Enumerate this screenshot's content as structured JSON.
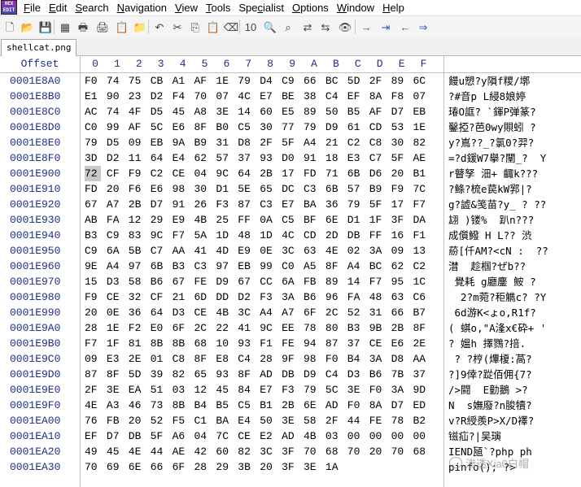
{
  "menu": {
    "items": [
      "File",
      "Edit",
      "Search",
      "Navigation",
      "View",
      "Tools",
      "Specialist",
      "Options",
      "Window",
      "Help"
    ],
    "mnemonics": [
      "F",
      "E",
      "S",
      "N",
      "V",
      "T",
      "c",
      "O",
      "W",
      "H"
    ]
  },
  "app_logo": "HEX EDIT",
  "toolbar": {
    "buttons": [
      {
        "name": "new-file-icon",
        "glyph": "🗋"
      },
      {
        "name": "open-file-icon",
        "glyph": "📂"
      },
      {
        "name": "save-icon",
        "glyph": "💾"
      },
      {
        "name": "save-all-icon",
        "glyph": "▦"
      },
      {
        "name": "print-icon",
        "glyph": "🖶"
      },
      {
        "name": "print-preview-icon",
        "glyph": "🖨"
      },
      {
        "name": "properties-icon",
        "glyph": "📋"
      },
      {
        "name": "folder-icon",
        "glyph": "📁"
      },
      {
        "name": "undo-icon",
        "glyph": "↶"
      },
      {
        "name": "cut-icon",
        "glyph": "✂"
      },
      {
        "name": "copy-icon",
        "glyph": "⎘"
      },
      {
        "name": "paste-icon",
        "glyph": "📋"
      },
      {
        "name": "delete-icon",
        "glyph": "⌫"
      },
      {
        "name": "insert-bits-icon",
        "glyph": "10"
      },
      {
        "name": "find-icon",
        "glyph": "🔍"
      },
      {
        "name": "find-hex-icon",
        "glyph": "⌕"
      },
      {
        "name": "replace-icon",
        "glyph": "⇄"
      },
      {
        "name": "replace-hex-icon",
        "glyph": "⇆"
      },
      {
        "name": "binoculars-icon",
        "glyph": "👁"
      },
      {
        "name": "goto-icon",
        "glyph": "→"
      },
      {
        "name": "goto-offset-icon",
        "glyph": "⇥"
      },
      {
        "name": "back-icon",
        "glyph": "←"
      },
      {
        "name": "forward-icon",
        "glyph": "⇒"
      }
    ]
  },
  "tab": {
    "label": "shellcat.png"
  },
  "grid": {
    "offset_header": "Offset",
    "columns": [
      "0",
      "1",
      "2",
      "3",
      "4",
      "5",
      "6",
      "7",
      "8",
      "9",
      "A",
      "B",
      "C",
      "D",
      "E",
      "F"
    ],
    "rows": [
      {
        "offset": "0001E8A0",
        "bytes": [
          "F0",
          "74",
          "75",
          "CB",
          "A1",
          "AF",
          "1E",
          "79",
          "D4",
          "C9",
          "66",
          "BC",
          "5D",
          "2F",
          "89",
          "6C"
        ],
        "ascii": "饅u愬?y隕f糭/墎"
      },
      {
        "offset": "0001E8B0",
        "bytes": [
          "E1",
          "90",
          "23",
          "D2",
          "F4",
          "70",
          "07",
          "4C",
          "E7",
          "BE",
          "38",
          "C4",
          "EF",
          "8A",
          "F8",
          "07"
        ],
        "ascii": "?#音p L綅8娘婷"
      },
      {
        "offset": "0001E8C0",
        "bytes": [
          "AC",
          "74",
          "4F",
          "D5",
          "45",
          "A8",
          "3E",
          "14",
          "60",
          "E5",
          "89",
          "50",
          "B5",
          "AF",
          "D7",
          "EB"
        ],
        "ascii": "瑃O誆? `鍕P弹篆?"
      },
      {
        "offset": "0001E8D0",
        "bytes": [
          "C0",
          "99",
          "AF",
          "5C",
          "E6",
          "8F",
          "B0",
          "C5",
          "30",
          "77",
          "79",
          "D9",
          "61",
          "CD",
          "53",
          "1E"
        ],
        "ascii": "鑿掗?芭0wy賏蚓 ?"
      },
      {
        "offset": "0001E8E0",
        "bytes": [
          "79",
          "D5",
          "09",
          "EB",
          "9A",
          "B9",
          "31",
          "D8",
          "2F",
          "5F",
          "A4",
          "21",
          "C2",
          "C8",
          "30",
          "82"
        ],
        "ascii": "y?嶌??_?氯0?羿?"
      },
      {
        "offset": "0001E8F0",
        "bytes": [
          "3D",
          "D2",
          "11",
          "64",
          "E4",
          "62",
          "57",
          "37",
          "93",
          "D0",
          "91",
          "18",
          "E3",
          "C7",
          "5F",
          "AE"
        ],
        "ascii": "=?d鍰W7擧?闉_?  Y"
      },
      {
        "offset": "0001E900",
        "bytes": [
          "72",
          "CF",
          "F9",
          "C2",
          "CE",
          "04",
          "9C",
          "64",
          "2B",
          "17",
          "FD",
          "71",
          "6B",
          "D6",
          "20",
          "B1"
        ],
        "ascii": "r瞽孥 沺+ 齱k???"
      },
      {
        "offset": "0001E910",
        "bytes": [
          "FD",
          "20",
          "F6",
          "E6",
          "98",
          "30",
          "D1",
          "5E",
          "65",
          "DC",
          "C3",
          "6B",
          "57",
          "B9",
          "F9",
          "7C"
        ],
        "ascii": "?鲦?梳e苠kW郛|?"
      },
      {
        "offset": "0001E920",
        "bytes": [
          "67",
          "A7",
          "2B",
          "D7",
          "91",
          "26",
          "F3",
          "87",
          "C3",
          "E7",
          "BA",
          "36",
          "79",
          "5F",
          "17",
          "F7"
        ],
        "ascii": "g?譃&笺苗?y_ ? ??"
      },
      {
        "offset": "0001E930",
        "bytes": [
          "AB",
          "FA",
          "12",
          "29",
          "E9",
          "4B",
          "25",
          "FF",
          "0A",
          "C5",
          "BF",
          "6E",
          "D1",
          "1F",
          "3F",
          "DA"
        ],
        "ascii": "翃 )镂%  趴n???"
      },
      {
        "offset": "0001E940",
        "bytes": [
          "B3",
          "C9",
          "83",
          "9C",
          "F7",
          "5A",
          "1D",
          "48",
          "1D",
          "4C",
          "CD",
          "2D",
          "DB",
          "FF",
          "16",
          "F1"
        ],
        "ascii": "成儨鱍 H L?? 渋"
      },
      {
        "offset": "0001E950",
        "bytes": [
          "C9",
          "6A",
          "5B",
          "C7",
          "AA",
          "41",
          "4D",
          "E9",
          "0E",
          "3C",
          "63",
          "4E",
          "02",
          "3A",
          "09",
          "13"
        ],
        "ascii": "蒶[仟AM?<cN :  ??"
      },
      {
        "offset": "0001E960",
        "bytes": [
          "9E",
          "A4",
          "97",
          "6B",
          "B3",
          "C3",
          "97",
          "EB",
          "99",
          "C0",
          "A5",
          "8F",
          "A4",
          "BC",
          "62",
          "C2"
        ],
        "ascii": "澘  趁椢?ぜb??"
      },
      {
        "offset": "0001E970",
        "bytes": [
          "15",
          "D3",
          "58",
          "B6",
          "67",
          "FE",
          "D9",
          "67",
          "CC",
          "6A",
          "FB",
          "89",
          "14",
          "F7",
          "95",
          "1C"
        ],
        "ascii": " 覺耗 g廳鏖 鮟 ?"
      },
      {
        "offset": "0001E980",
        "bytes": [
          "F9",
          "CE",
          "32",
          "CF",
          "21",
          "6D",
          "DD",
          "D2",
          "F3",
          "3A",
          "B6",
          "96",
          "FA",
          "48",
          "63",
          "C6"
        ],
        "ascii": "  2?m菀?秬觹c? ?Y"
      },
      {
        "offset": "0001E990",
        "bytes": [
          "20",
          "0E",
          "36",
          "64",
          "D3",
          "CE",
          "4B",
          "3C",
          "A4",
          "A7",
          "6F",
          "2C",
          "52",
          "31",
          "66",
          "B7"
        ],
        "ascii": " 6d游K<ょo,R1f?"
      },
      {
        "offset": "0001E9A0",
        "bytes": [
          "28",
          "1E",
          "F2",
          "E0",
          "6F",
          "2C",
          "22",
          "41",
          "9C",
          "EE",
          "78",
          "80",
          "B3",
          "9B",
          "2B",
          "8F"
        ],
        "ascii": "( 蜞o,\"A湰x€砕+ '"
      },
      {
        "offset": "0001E9B0",
        "bytes": [
          "F7",
          "1F",
          "81",
          "8B",
          "8B",
          "68",
          "10",
          "93",
          "F1",
          "FE",
          "94",
          "87",
          "37",
          "CE",
          "E6",
          "2E"
        ],
        "ascii": "? 媼h 擇鷚?掊."
      },
      {
        "offset": "0001E9C0",
        "bytes": [
          "09",
          "E3",
          "2E",
          "01",
          "C8",
          "8F",
          "E8",
          "C4",
          "28",
          "9F",
          "98",
          "F0",
          "B4",
          "3A",
          "D8",
          "AA"
        ],
        "ascii": " ? ?梈(熚榎:萵?"
      },
      {
        "offset": "0001E9D0",
        "bytes": [
          "87",
          "8F",
          "5D",
          "39",
          "82",
          "65",
          "93",
          "8F",
          "AD",
          "DB",
          "D9",
          "C4",
          "D3",
          "B6",
          "7B",
          "37"
        ],
        "ascii": "?]9倖?踨佰佣{7?"
      },
      {
        "offset": "0001E9E0",
        "bytes": [
          "2F",
          "3E",
          "EA",
          "51",
          "03",
          "12",
          "45",
          "84",
          "E7",
          "F3",
          "79",
          "5C",
          "3E",
          "F0",
          "3A",
          "9D"
        ],
        "ascii": "/>闘  E勭鵝 >?"
      },
      {
        "offset": "0001E9F0",
        "bytes": [
          "4E",
          "A3",
          "46",
          "73",
          "8B",
          "B4",
          "B5",
          "C5",
          "B1",
          "2B",
          "6E",
          "AD",
          "F0",
          "8A",
          "D7",
          "ED"
        ],
        "ascii": "N  s嫵廢?n朘犢?"
      },
      {
        "offset": "0001EA00",
        "bytes": [
          "76",
          "FB",
          "20",
          "52",
          "F5",
          "C1",
          "BA",
          "E4",
          "50",
          "3E",
          "58",
          "2F",
          "44",
          "FE",
          "78",
          "B2"
        ],
        "ascii": "v?R綬羨P>X/D襗?"
      },
      {
        "offset": "0001EA10",
        "bytes": [
          "EF",
          "D7",
          "DB",
          "5F",
          "A6",
          "04",
          "7C",
          "CE",
          "E2",
          "AD",
          "4B",
          "03",
          "00",
          "00",
          "00",
          "00"
        ],
        "ascii": "镃疝?|吴璌"
      },
      {
        "offset": "0001EA20",
        "bytes": [
          "49",
          "45",
          "4E",
          "44",
          "AE",
          "42",
          "60",
          "82",
          "3C",
          "3F",
          "70",
          "68",
          "70",
          "20",
          "70",
          "68"
        ],
        "ascii": "IEND瓸`?php ph"
      },
      {
        "offset": "0001EA30",
        "bytes": [
          "70",
          "69",
          "6E",
          "66",
          "6F",
          "28",
          "29",
          "3B",
          "20",
          "3F",
          "3E",
          "1A",
          "",
          "",
          "",
          ""
        ],
        "ascii": "pinfo(); ?>"
      }
    ],
    "selected": {
      "row": 6,
      "col": 0
    }
  },
  "watermark": "渗透Xia0白帽"
}
